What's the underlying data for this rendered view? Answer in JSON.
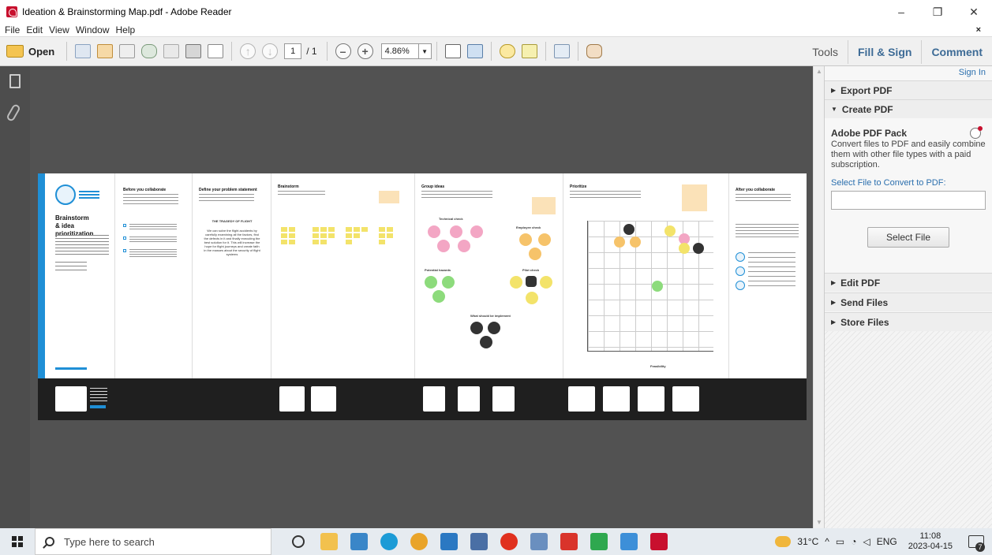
{
  "window": {
    "title": "Ideation & Brainstorming Map.pdf - Adobe Reader",
    "minimize": "–",
    "restore": "❐",
    "close": "✕"
  },
  "menu": {
    "items": [
      "File",
      "Edit",
      "View",
      "Window",
      "Help"
    ],
    "close_doc": "×"
  },
  "toolbar": {
    "open_label": "Open",
    "page_current": "1",
    "page_total": "/ 1",
    "zoom": "4.86%",
    "tools_label": "Tools",
    "fill_sign_label": "Fill & Sign",
    "comment_label": "Comment"
  },
  "right_pane": {
    "sign_in": "Sign In",
    "sections": {
      "export_pdf": "Export PDF",
      "create_pdf": "Create PDF",
      "edit_pdf": "Edit PDF",
      "send_files": "Send Files",
      "store_files": "Store Files"
    },
    "pack_title": "Adobe PDF Pack",
    "pack_desc": "Convert files to PDF and easily combine them with other file types with a paid subscription.",
    "select_label": "Select File to Convert to PDF:",
    "select_button": "Select File"
  },
  "pdf": {
    "cover_title_1": "Brainstorm",
    "cover_title_2": "& idea prioritization",
    "panel2_title": "Before you collaborate",
    "panel3_title": "Define your problem statement",
    "panel3_heading": "THE TRAGEDY OF FLIGHT",
    "panel3_body": "We can solve the flight accidents by carefully examining all the factors, find the defects in it and finally executing the best solution for it. This will increase the hope for flight journeys and create faith in the masses about the security of flight systems",
    "panel4_title": "Brainstorm",
    "panel5_title": "Group ideas",
    "panel5_groups": [
      "Technical check",
      "Employee check",
      "Potential hazards",
      "Pilot check",
      "What should be implement"
    ],
    "panel6_title": "Prioritize",
    "panel6_xlabel": "Feasibility",
    "panel7_title": "After you collaborate"
  },
  "taskbar": {
    "search_placeholder": "Type here to search",
    "weather": "31°C",
    "lang": "ENG",
    "time": "11:08",
    "date": "2023-04-15",
    "notif_count": "7"
  },
  "colors": {
    "accent_blue": "#1f8fd6",
    "adobe_red": "#c8102e",
    "link_blue": "#2b6fae",
    "sticky_yellow": "#f3e36a"
  }
}
